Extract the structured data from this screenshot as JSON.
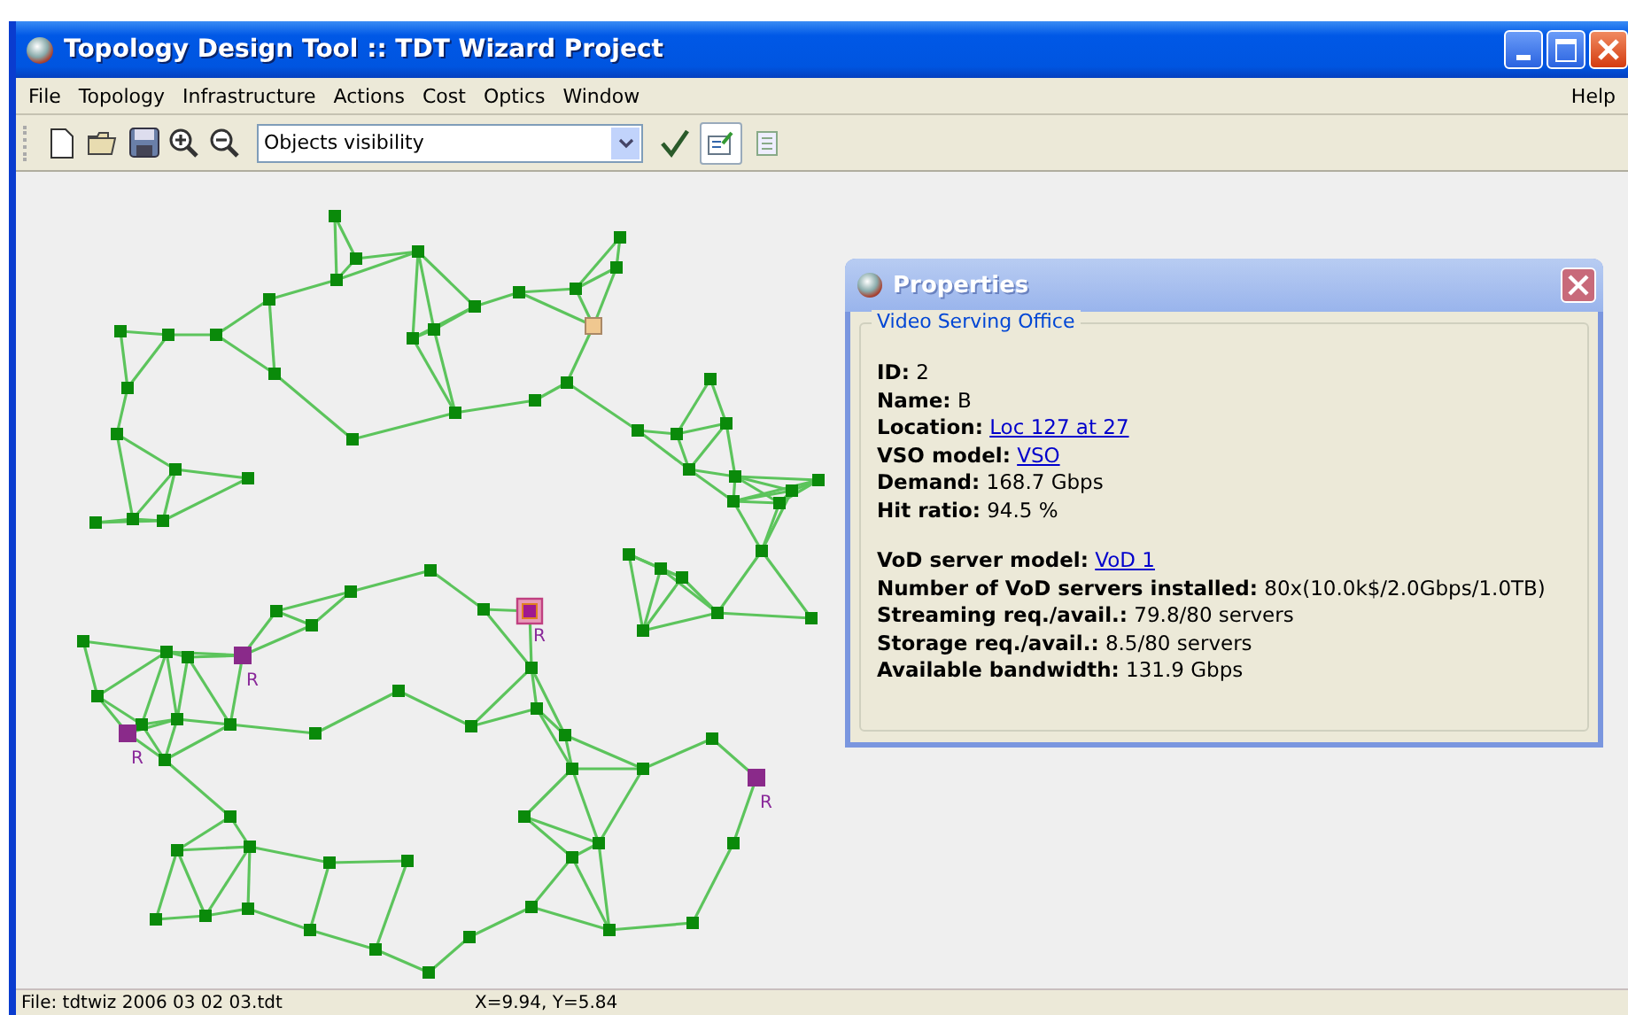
{
  "window": {
    "title": "Topology Design Tool :: TDT Wizard Project"
  },
  "menu": {
    "items": [
      "File",
      "Topology",
      "Infrastructure",
      "Actions",
      "Cost",
      "Optics",
      "Window"
    ],
    "help": "Help"
  },
  "toolbar": {
    "view_select": "Objects visibility"
  },
  "graph": {
    "vso_nodes": [
      {
        "label": "R",
        "selected": true
      },
      {
        "label": "R",
        "selected": false
      },
      {
        "label": "R",
        "selected": false
      },
      {
        "label": "R",
        "selected": false
      }
    ]
  },
  "properties": {
    "title": "Properties",
    "group_title": "Video Serving Office",
    "sections": [
      [
        {
          "label": "ID:",
          "value": "2",
          "link": false
        },
        {
          "label": "Name:",
          "value": "B",
          "link": false
        },
        {
          "label": "Location:",
          "value": "Loc 127 at 27",
          "link": true
        },
        {
          "label": "VSO model:",
          "value": "VSO",
          "link": true
        },
        {
          "label": "Demand:",
          "value": "168.7 Gbps",
          "link": false
        },
        {
          "label": "Hit ratio:",
          "value": "94.5 %",
          "link": false
        }
      ],
      [
        {
          "label": "VoD server model:",
          "value": "VoD 1",
          "link": true
        },
        {
          "label": "Number of VoD servers installed:",
          "value": "80x(10.0k$/2.0Gbps/1.0TB)",
          "link": false
        },
        {
          "label": "Streaming req./avail.:",
          "value": "79.8/80 servers",
          "link": false
        },
        {
          "label": "Storage req./avail.:",
          "value": "8.5/80 servers",
          "link": false
        },
        {
          "label": "Available bandwidth:",
          "value": "131.9 Gbps",
          "link": false
        }
      ]
    ]
  },
  "status_bar": {
    "file": "File: tdtwiz 2006 03 02 03.tdt",
    "coords": "X=9.94, Y=5.84"
  }
}
